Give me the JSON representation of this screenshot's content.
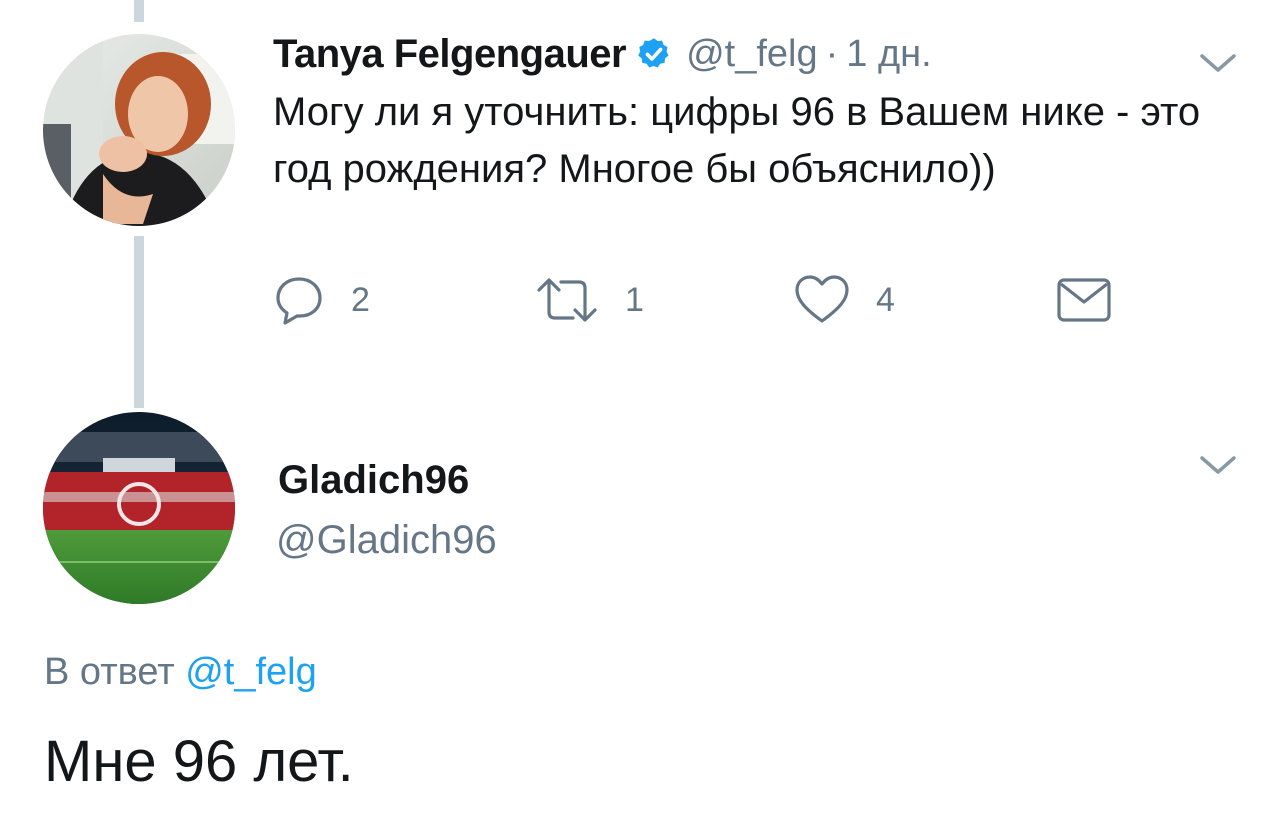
{
  "tweet": {
    "author_name": "Tanya Felgengauer",
    "author_handle": "@t_felg",
    "separator": "·",
    "time": "1 дн.",
    "text": "Могу ли я уточнить: цифры 96 в Вашем нике - это год рождения? Многое бы объяснило))",
    "reply_count": "2",
    "retweet_count": "1",
    "like_count": "4",
    "icons": {
      "verified": "verified-badge-icon",
      "menu": "chevron-down-icon",
      "reply": "reply-icon",
      "retweet": "retweet-icon",
      "like": "heart-icon",
      "dm": "envelope-icon"
    }
  },
  "reply": {
    "author_name": "Gladich96",
    "author_handle": "@Gladich96",
    "reply_prefix": "В ответ",
    "reply_mention": "@t_felg",
    "text": "Мне 96 лет."
  },
  "colors": {
    "text_primary": "#14171a",
    "text_secondary": "#657786",
    "link": "#1da1f2",
    "thread_line": "#ccd6dd",
    "verified": "#1da1f2"
  }
}
